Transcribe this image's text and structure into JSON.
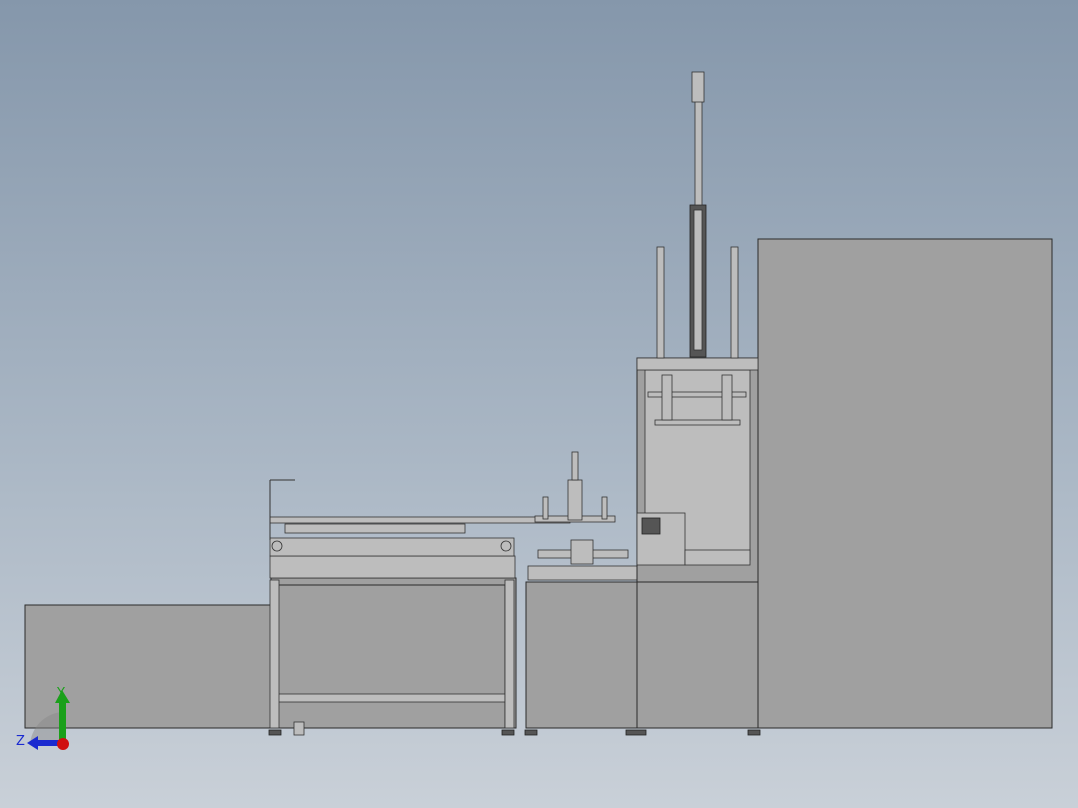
{
  "viewport": {
    "triad": {
      "y_label": "Y",
      "z_label": "Z"
    },
    "colors": {
      "y_axis": "#1aa01a",
      "z_axis": "#1a2ad0",
      "origin": "#d01010",
      "model": "#a0a0a0"
    }
  }
}
